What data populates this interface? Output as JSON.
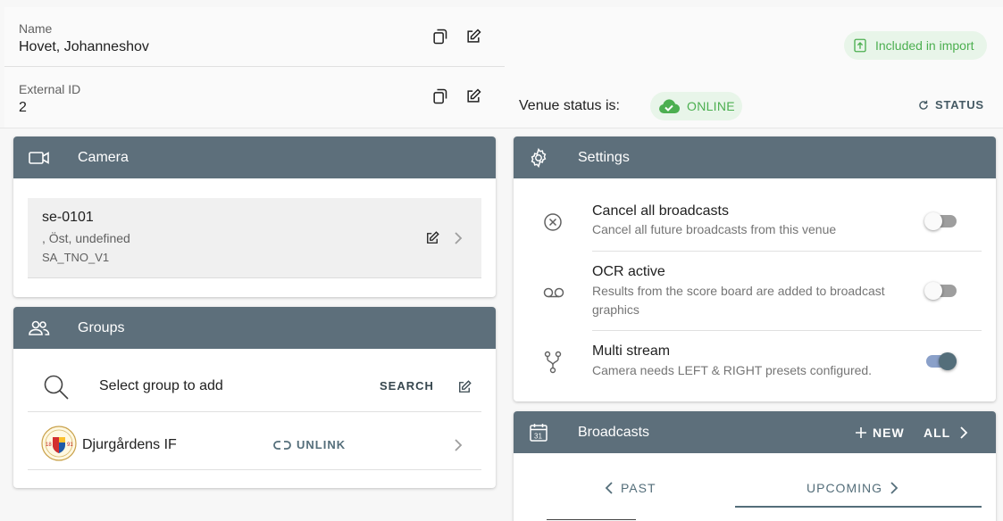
{
  "venue": {
    "name_label": "Name",
    "name_value": "Hovet, Johanneshov",
    "external_id_label": "External ID",
    "external_id_value": "2",
    "import_chip": "Included in import",
    "status_label": "Venue status is:",
    "status_value": "ONLINE",
    "status_button": "STATUS"
  },
  "camera": {
    "title": "Camera",
    "item": {
      "name": "se-0101",
      "location": ", Öst, undefined",
      "model": "SA_TNO_V1"
    }
  },
  "groups": {
    "title": "Groups",
    "search_placeholder": "Select group to add",
    "search_button": "SEARCH",
    "items": [
      {
        "name": "Djurgårdens IF",
        "unlink_label": "UNLINK"
      }
    ]
  },
  "settings": {
    "title": "Settings",
    "rows": [
      {
        "title": "Cancel all broadcasts",
        "subtitle": "Cancel all future broadcasts from this venue",
        "enabled": false,
        "icon": "cancel-circle-icon"
      },
      {
        "title": "OCR active",
        "subtitle": "Results from the score board are added to broadcast graphics",
        "enabled": false,
        "icon": "voicemail-icon"
      },
      {
        "title": "Multi stream",
        "subtitle": "Camera needs LEFT & RIGHT presets configured.",
        "enabled": true,
        "icon": "fork-icon"
      }
    ]
  },
  "broadcasts": {
    "title": "Broadcasts",
    "new_label": "NEW",
    "all_label": "ALL",
    "tabs": [
      {
        "label": "PAST",
        "active": false
      },
      {
        "label": "UPCOMING",
        "active": true
      }
    ]
  },
  "colors": {
    "header": "#5d6f7b",
    "online": "#4caf50",
    "chip_bg": "#e8f5e9"
  }
}
